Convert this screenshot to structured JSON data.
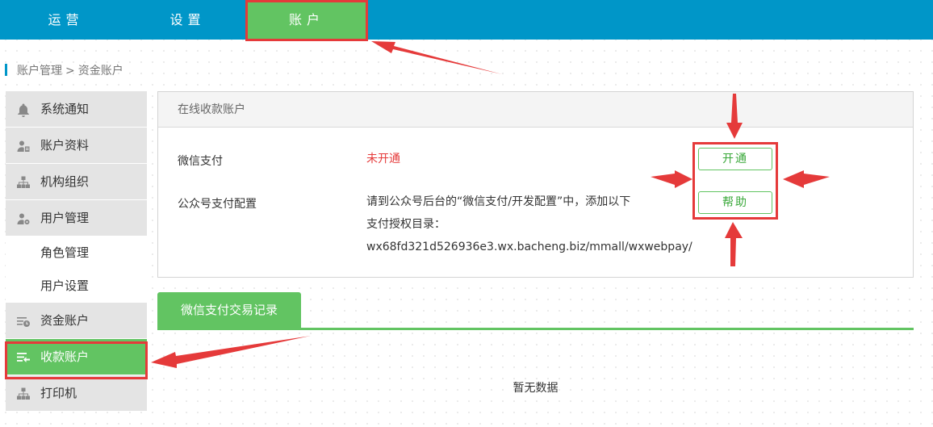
{
  "topnav": {
    "tabs": [
      {
        "label": "运营"
      },
      {
        "label": "设置"
      },
      {
        "label": "账户"
      }
    ]
  },
  "breadcrumb": {
    "parent": "账户管理",
    "separator": ">",
    "current": "资金账户"
  },
  "sidebar": {
    "items": [
      {
        "label": "系统通知",
        "icon": "bell-icon"
      },
      {
        "label": "账户资料",
        "icon": "user-profile-icon"
      },
      {
        "label": "机构组织",
        "icon": "org-tree-icon"
      },
      {
        "label": "用户管理",
        "icon": "user-gear-icon"
      }
    ],
    "subitems": [
      {
        "label": "角色管理"
      },
      {
        "label": "用户设置"
      }
    ],
    "items2": [
      {
        "label": "资金账户",
        "icon": "fund-account-icon"
      },
      {
        "label": "收款账户",
        "icon": "receive-account-icon"
      },
      {
        "label": "打印机",
        "icon": "printer-tree-icon"
      }
    ]
  },
  "panel": {
    "title": "在线收款账户",
    "wechat_label": "微信支付",
    "wechat_status": "未开通",
    "config_label": "公众号支付配置",
    "config_line1": "请到公众号后台的“微信支付/开发配置”中，添加以下",
    "config_line2": "支付授权目录：",
    "config_line3": "wx68fd321d526936e3.wx.bacheng.biz/mmall/wxwebpay/",
    "open_button": "开通",
    "help_button": "帮助"
  },
  "records": {
    "tab_label": "微信支付交易记录",
    "empty_text": "暂无数据"
  },
  "colors": {
    "topnav": "#0096c8",
    "accent_green": "#62c462",
    "annotation_red": "#e53a3a",
    "status_red": "#e53a3a"
  }
}
